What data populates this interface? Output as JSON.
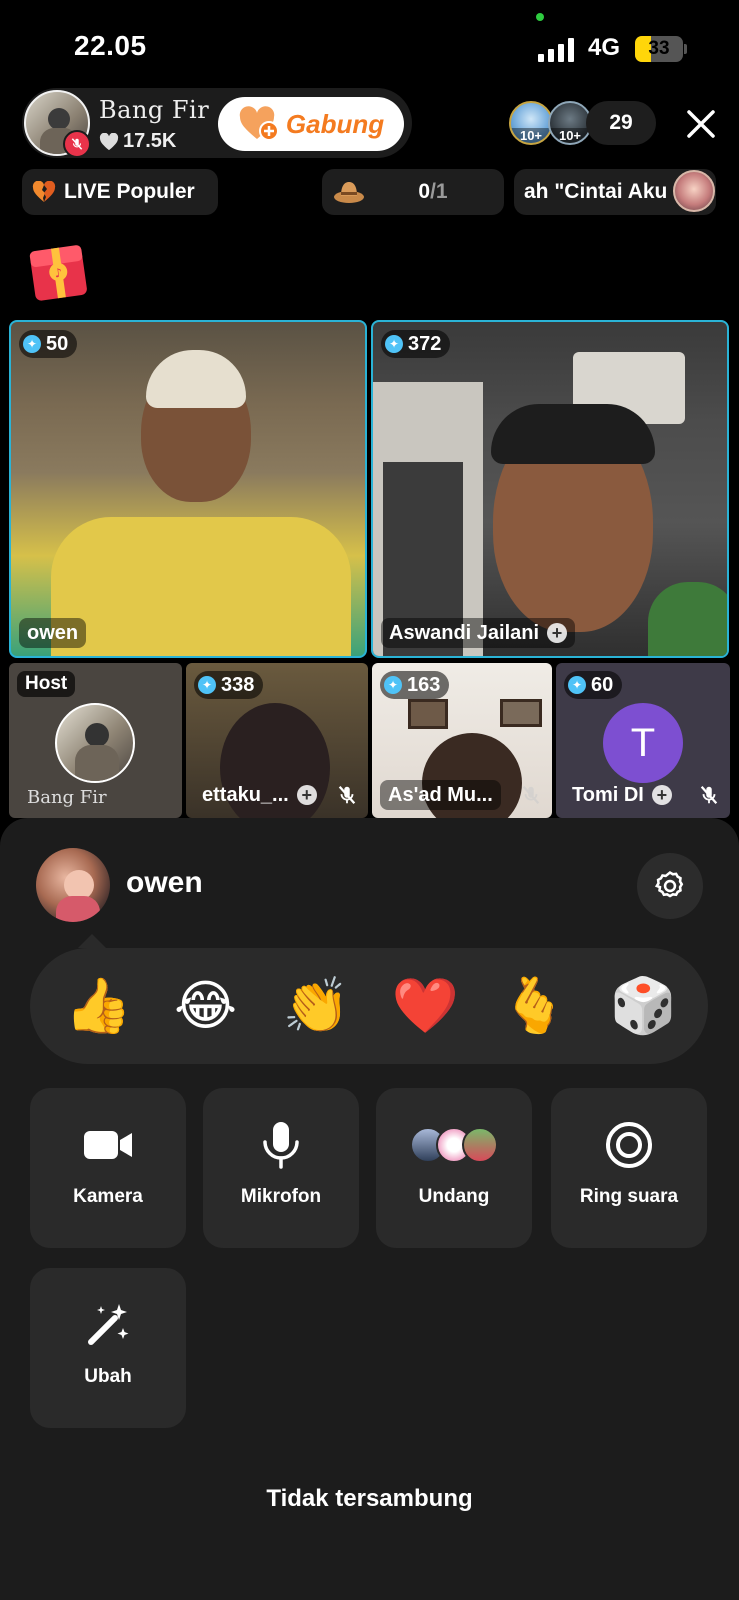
{
  "status_bar": {
    "time": "22.05",
    "network": "4G",
    "battery": "33",
    "battery_level": 0.33
  },
  "host": {
    "name": "Bang Fir",
    "likes": "17.5K",
    "join_label": "Gabung"
  },
  "viewers": {
    "badges": [
      "10+",
      "10+"
    ],
    "count": "29"
  },
  "chips": {
    "populer_label": "LIVE Populer",
    "goal_current": "0",
    "goal_total": "/1",
    "marquee_text": "ah \"Cintai Aku"
  },
  "grid": {
    "big": [
      {
        "score": "50",
        "name": "owen"
      },
      {
        "score": "372",
        "name": "Aswandi Jailani"
      }
    ],
    "small": [
      {
        "tag": "Host",
        "name": "Bang Fir"
      },
      {
        "score": "338",
        "name": "ettaku_..."
      },
      {
        "score": "163",
        "name": "As'ad Mu..."
      },
      {
        "score": "60",
        "name": "Tomi DI",
        "initial": "T"
      }
    ]
  },
  "sheet": {
    "user_name": "owen",
    "reactions": [
      "👍",
      "😂",
      "👏",
      "❤️",
      "🫰",
      "🎲"
    ],
    "actions": [
      {
        "label": "Kamera",
        "icon": "camera-icon"
      },
      {
        "label": "Mikrofon",
        "icon": "microphone-icon"
      },
      {
        "label": "Undang",
        "icon": "invite-avatars"
      },
      {
        "label": "Ring suara",
        "icon": "ring-icon"
      },
      {
        "label": "Ubah",
        "icon": "magic-wand-icon"
      }
    ],
    "status_text": "Tidak tersambung"
  },
  "colors": {
    "accent_orange": "#f47b20",
    "tile_border": "#2ab3d6",
    "mute_red": "#e8334a",
    "avatar_purple": "#7d4fd1",
    "battery_yellow": "#ffd60a"
  }
}
